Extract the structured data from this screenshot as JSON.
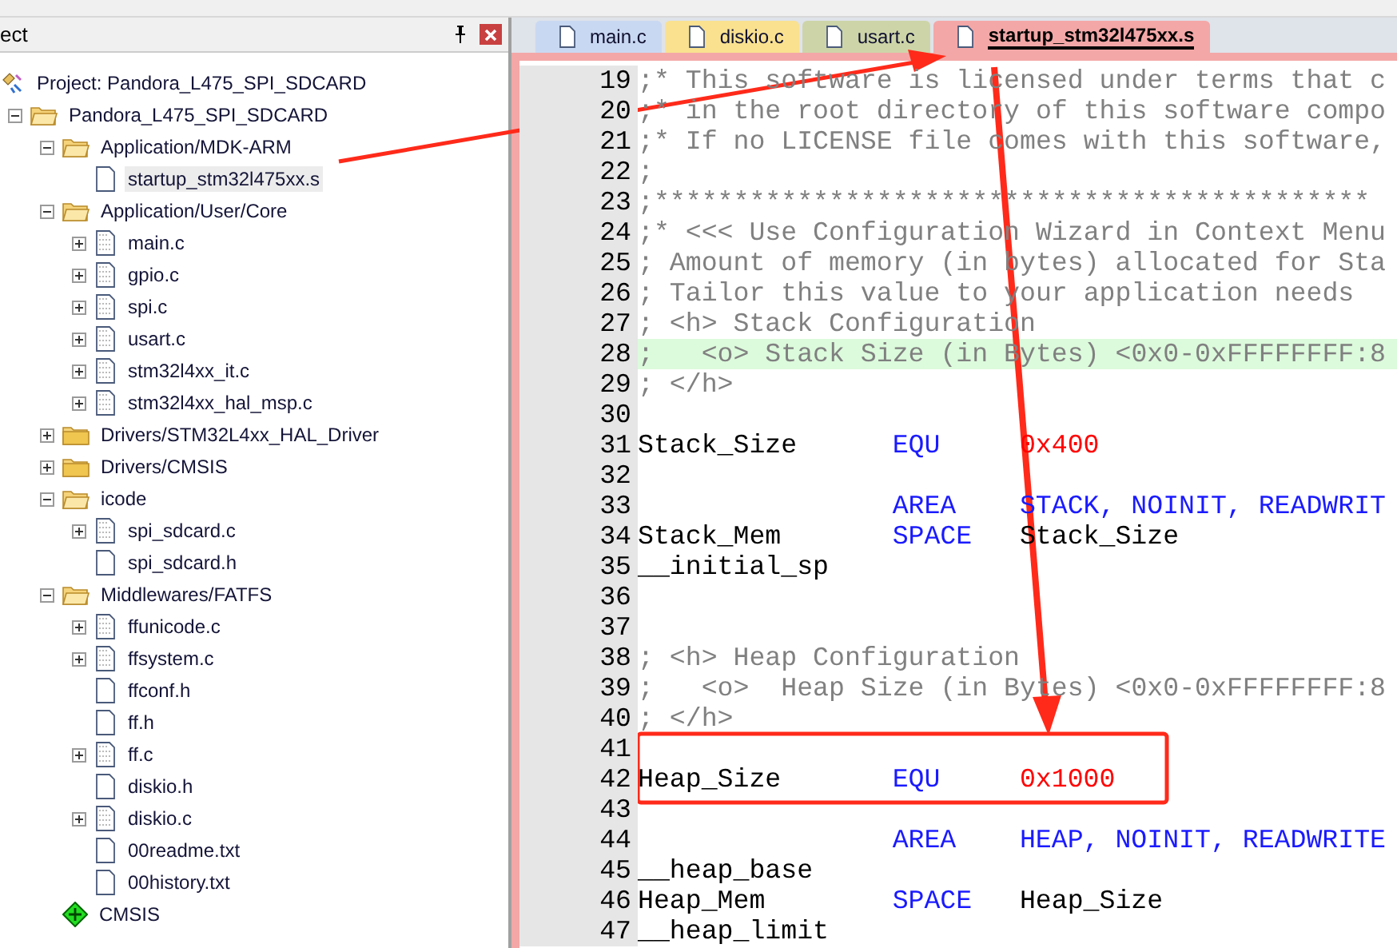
{
  "panel": {
    "title": "ect"
  },
  "tree": [
    {
      "label": "Project: Pandora_L475_SPI_SDCARD",
      "kind": "project",
      "selected": false,
      "children": [
        {
          "label": "Pandora_L475_SPI_SDCARD",
          "kind": "target",
          "expanded": true,
          "selected": false,
          "children": [
            {
              "label": "Application/MDK-ARM",
              "kind": "folder",
              "expanded": true,
              "selected": false,
              "children": [
                {
                  "label": "startup_stm32l475xx.s",
                  "kind": "file",
                  "selected": true
                }
              ]
            },
            {
              "label": "Application/User/Core",
              "kind": "folder",
              "expanded": true,
              "selected": false,
              "children": [
                {
                  "label": "main.c",
                  "kind": "file",
                  "expanded": false,
                  "selected": false
                },
                {
                  "label": "gpio.c",
                  "kind": "file",
                  "expanded": false,
                  "selected": false
                },
                {
                  "label": "spi.c",
                  "kind": "file",
                  "expanded": false,
                  "selected": false
                },
                {
                  "label": "usart.c",
                  "kind": "file",
                  "expanded": false,
                  "selected": false
                },
                {
                  "label": "stm32l4xx_it.c",
                  "kind": "file",
                  "expanded": false,
                  "selected": false
                },
                {
                  "label": "stm32l4xx_hal_msp.c",
                  "kind": "file",
                  "expanded": false,
                  "selected": false
                }
              ]
            },
            {
              "label": "Drivers/STM32L4xx_HAL_Driver",
              "kind": "folder",
              "expanded": false,
              "selected": false
            },
            {
              "label": "Drivers/CMSIS",
              "kind": "folder",
              "expanded": false,
              "selected": false
            },
            {
              "label": "icode",
              "kind": "folder",
              "expanded": true,
              "selected": false,
              "children": [
                {
                  "label": "spi_sdcard.c",
                  "kind": "file",
                  "expanded": false,
                  "selected": false
                },
                {
                  "label": "spi_sdcard.h",
                  "kind": "file",
                  "selected": false
                }
              ]
            },
            {
              "label": "Middlewares/FATFS",
              "kind": "folder",
              "expanded": true,
              "selected": false,
              "children": [
                {
                  "label": "ffunicode.c",
                  "kind": "file",
                  "expanded": false,
                  "selected": false
                },
                {
                  "label": "ffsystem.c",
                  "kind": "file",
                  "expanded": false,
                  "selected": false
                },
                {
                  "label": "ffconf.h",
                  "kind": "file",
                  "selected": false
                },
                {
                  "label": "ff.h",
                  "kind": "file",
                  "selected": false
                },
                {
                  "label": "ff.c",
                  "kind": "file",
                  "expanded": false,
                  "selected": false
                },
                {
                  "label": "diskio.h",
                  "kind": "file",
                  "selected": false
                },
                {
                  "label": "diskio.c",
                  "kind": "file",
                  "expanded": false,
                  "selected": false
                },
                {
                  "label": "00readme.txt",
                  "kind": "file",
                  "selected": false
                },
                {
                  "label": "00history.txt",
                  "kind": "file",
                  "selected": false
                }
              ]
            },
            {
              "label": "CMSIS",
              "kind": "component",
              "selected": false
            }
          ]
        }
      ]
    }
  ],
  "tabs": [
    {
      "label": "main.c",
      "color": "#c9d8f2",
      "selected": false
    },
    {
      "label": "diskio.c",
      "color": "#f9e190",
      "selected": false
    },
    {
      "label": "usart.c",
      "color": "#cdd5a8",
      "selected": false
    },
    {
      "label": "startup_stm32l475xx.s",
      "color": "#f3a7a7",
      "selected": true
    }
  ],
  "code": [
    {
      "number": "19",
      "kind": "comment",
      "highlighted": false,
      "text": ";* This software is licensed under terms that c"
    },
    {
      "number": "20",
      "kind": "comment",
      "highlighted": false,
      "text": ";* in the root directory of this software compo"
    },
    {
      "number": "21",
      "kind": "comment",
      "highlighted": false,
      "text": ";* If no LICENSE file comes with this software,"
    },
    {
      "number": "22",
      "kind": "comment",
      "highlighted": false,
      "text": ";"
    },
    {
      "number": "23",
      "kind": "comment",
      "highlighted": false,
      "text": ";*********************************************"
    },
    {
      "number": "24",
      "kind": "comment",
      "highlighted": false,
      "text": ";* <<< Use Configuration Wizard in Context Menu"
    },
    {
      "number": "25",
      "kind": "comment",
      "highlighted": false,
      "text": "; Amount of memory (in bytes) allocated for Sta"
    },
    {
      "number": "26",
      "kind": "comment",
      "highlighted": false,
      "text": "; Tailor this value to your application needs"
    },
    {
      "number": "27",
      "kind": "comment",
      "highlighted": false,
      "text": "; <h> Stack Configuration"
    },
    {
      "number": "28",
      "kind": "comment",
      "highlighted": true,
      "text": ";   <o> Stack Size (in Bytes) <0x0-0xFFFFFFFF:8"
    },
    {
      "number": "29",
      "kind": "comment",
      "highlighted": false,
      "text": "; </h>"
    },
    {
      "number": "30",
      "kind": "blank",
      "highlighted": false
    },
    {
      "number": "31",
      "kind": "statement",
      "highlighted": false,
      "label": "Stack_Size",
      "directive": "EQU",
      "operand": {
        "text": "0x400",
        "kind": "number"
      }
    },
    {
      "number": "32",
      "kind": "blank",
      "highlighted": false
    },
    {
      "number": "33",
      "kind": "statement",
      "highlighted": false,
      "directive": "AREA",
      "operand": {
        "text": "STACK, NOINIT, READWRIT",
        "kind": "keyword"
      }
    },
    {
      "number": "34",
      "kind": "statement",
      "highlighted": false,
      "label": "Stack_Mem",
      "directive": "SPACE",
      "operand": {
        "text": "Stack_Size",
        "kind": "symbol"
      }
    },
    {
      "number": "35",
      "kind": "statement",
      "highlighted": false,
      "label": "__initial_sp"
    },
    {
      "number": "36",
      "kind": "blank",
      "highlighted": false
    },
    {
      "number": "37",
      "kind": "blank",
      "highlighted": false
    },
    {
      "number": "38",
      "kind": "comment",
      "highlighted": false,
      "text": "; <h> Heap Configuration"
    },
    {
      "number": "39",
      "kind": "comment",
      "highlighted": false,
      "text": ";   <o>  Heap Size (in Bytes) <0x0-0xFFFFFFFF:8"
    },
    {
      "number": "40",
      "kind": "comment",
      "highlighted": false,
      "text": "; </h>"
    },
    {
      "number": "41",
      "kind": "blank",
      "highlighted": false
    },
    {
      "number": "42",
      "kind": "statement",
      "highlighted": false,
      "label": "Heap_Size",
      "directive": "EQU",
      "operand": {
        "text": "0x1000",
        "kind": "number"
      }
    },
    {
      "number": "43",
      "kind": "blank",
      "highlighted": false
    },
    {
      "number": "44",
      "kind": "statement",
      "highlighted": false,
      "directive": "AREA",
      "operand": {
        "text": "HEAP, NOINIT, READWRITE",
        "kind": "keyword"
      }
    },
    {
      "number": "45",
      "kind": "statement",
      "highlighted": false,
      "label": "__heap_base"
    },
    {
      "number": "46",
      "kind": "statement",
      "highlighted": false,
      "label": "Heap_Mem",
      "directive": "SPACE",
      "operand": {
        "text": "Heap_Size",
        "kind": "symbol"
      }
    },
    {
      "number": "47",
      "kind": "statement",
      "highlighted": false,
      "label": "__heap_limit"
    }
  ]
}
